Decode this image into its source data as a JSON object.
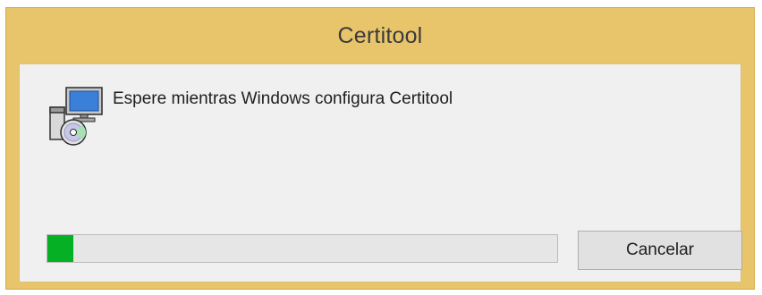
{
  "window": {
    "title": "Certitool"
  },
  "dialog": {
    "icon": "windows-installer-icon",
    "message": "Espere mientras Windows configura Certitool",
    "progress_percent": 5,
    "cancel_label": "Cancelar"
  },
  "colors": {
    "titlebar": "#e8c46b",
    "client": "#f0f0f0",
    "progress_fill": "#06b025",
    "progress_track": "#e6e6e6",
    "button": "#e1e1e1"
  }
}
